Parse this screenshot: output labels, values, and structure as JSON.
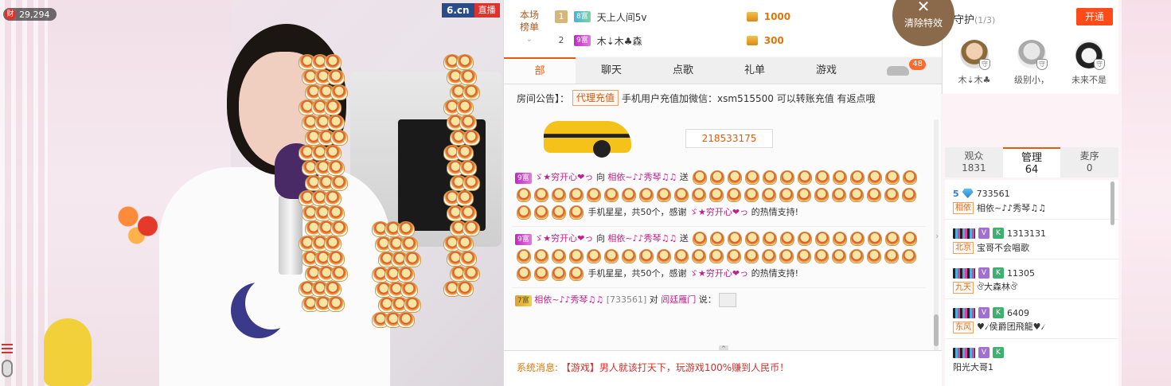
{
  "video": {
    "viewer_count": "29,294",
    "coin_icon": "财",
    "logo_text": "6.cn",
    "live_label": "直播"
  },
  "rank": {
    "label_line1": "本场",
    "label_line2": "榜单",
    "chevron": "⌄",
    "rows": [
      {
        "num": "1",
        "level": "8富",
        "name": "天上人间5v",
        "score": "1000"
      },
      {
        "num": "2",
        "level": "9富",
        "name": "木⇣木♣森",
        "score": "300"
      }
    ]
  },
  "clear_fx": {
    "x": "✕",
    "label": "清除特效"
  },
  "tabs": {
    "all": "部",
    "chat": "聊天",
    "song": "点歌",
    "gift": "礼单",
    "game": "游戏",
    "car_badge": "48"
  },
  "notice": {
    "prefix": "房间公告】：",
    "pill": "代理充值",
    "text": "手机用户充值加微信：xsm515500 可以转账充值 有返点哦"
  },
  "car": {
    "id": "218533175"
  },
  "messages": [
    {
      "level": "9富",
      "from": "ゞ★穷开心❤っ",
      "to_word": "向",
      "to": "相依~♪♪秀琴♫♫",
      "send": "送",
      "tail": "手机星星，共50个，感谢",
      "thanks_name": "ゞ★穷开心❤っ",
      "end": "的热情支持!"
    },
    {
      "level": "9富",
      "from": "ゞ★穷开心❤っ",
      "to_word": "向",
      "to": "相依~♪♪秀琴♫♫",
      "send": "送",
      "tail": "手机星星，共50个，感谢",
      "thanks_name": "ゞ★穷开心❤っ",
      "end": "的热情支持!"
    }
  ],
  "last_msg": {
    "level": "7富",
    "from": "相依~♪♪秀琴♫♫",
    "id": "[733561]",
    "to_word": "对",
    "to": "闾廷雁门",
    "say": "说："
  },
  "system": {
    "label": "系统消息:",
    "body": "【游戏】男人就该打天下，玩游戏100%赚到人民币！"
  },
  "guard": {
    "title": "守护",
    "count": "(1/3)",
    "open_button": "开通",
    "users": [
      {
        "name": "木⇣木♣"
      },
      {
        "name": "级别小，"
      },
      {
        "name": "未来不是"
      }
    ]
  },
  "user_tabs": [
    {
      "label": "观众",
      "count": "1831"
    },
    {
      "label": "管理",
      "count": "64"
    },
    {
      "label": "麦序",
      "count": "0"
    }
  ],
  "user_list": [
    {
      "level_num": "5",
      "id": "733561",
      "place": "相依",
      "name": "相依~♪♪秀琴♫♫"
    },
    {
      "id": "1313131",
      "place": "北京",
      "name": "宝哥不会唱歌"
    },
    {
      "id": "11305",
      "place": "九天",
      "name": "ঔ大森林ঔ"
    },
    {
      "id": "6409",
      "place": "东风",
      "name": "♥৴侯爵团飛龍♥৴"
    },
    {
      "id": "",
      "place": "",
      "name": "阳光大哥1"
    }
  ],
  "colors": {
    "accent": "#e85a0a",
    "open_button": "#ff4a1a",
    "logo_blue": "#2a4d8a",
    "live_red": "#e0322c"
  }
}
